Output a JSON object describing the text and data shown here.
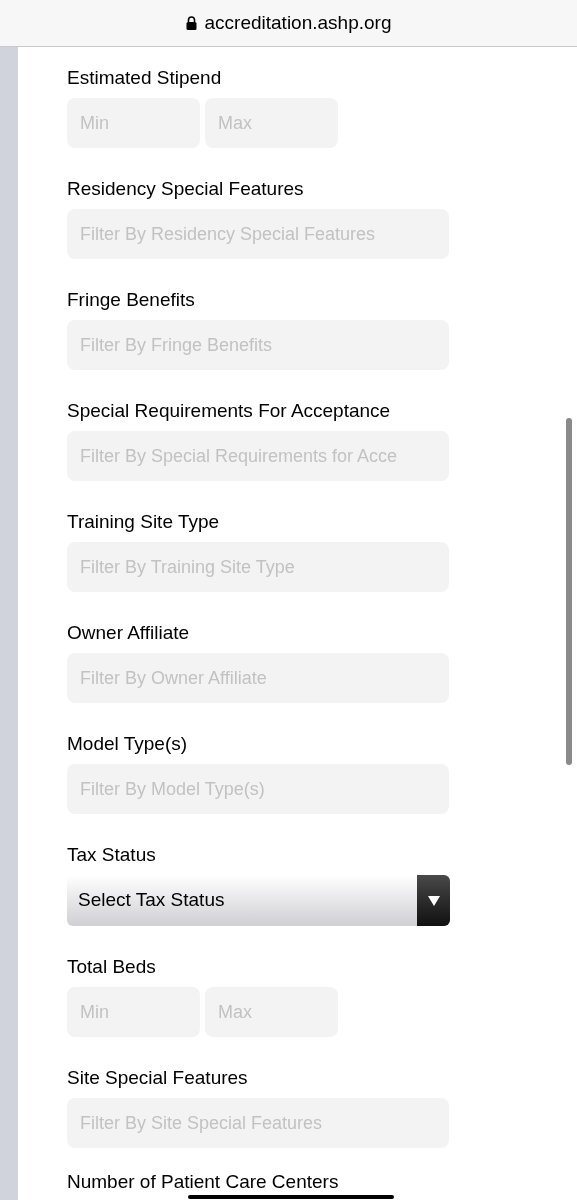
{
  "browser_bar": {
    "url": "accreditation.ashp.org"
  },
  "filters": [
    {
      "kind": "range",
      "label": "Estimated Stipend",
      "placeholders": [
        "Min",
        "Max"
      ]
    },
    {
      "kind": "text",
      "label": "Residency Special Features",
      "placeholder": "Filter By Residency Special Features"
    },
    {
      "kind": "text",
      "label": "Fringe Benefits",
      "placeholder": "Filter By Fringe Benefits"
    },
    {
      "kind": "text",
      "label": "Special Requirements For Acceptance",
      "placeholder": "Filter By Special Requirements for Acce"
    },
    {
      "kind": "text",
      "label": "Training Site Type",
      "placeholder": "Filter By Training Site Type"
    },
    {
      "kind": "text",
      "label": "Owner Affiliate",
      "placeholder": "Filter By Owner Affiliate"
    },
    {
      "kind": "text",
      "label": "Model Type(s)",
      "placeholder": "Filter By Model Type(s)"
    },
    {
      "kind": "select",
      "label": "Tax Status",
      "value": "Select Tax Status"
    },
    {
      "kind": "range",
      "label": "Total Beds",
      "placeholders": [
        "Min",
        "Max"
      ]
    },
    {
      "kind": "text",
      "label": "Site Special Features",
      "placeholder": "Filter By Site Special Features"
    },
    {
      "kind": "heading",
      "label": "Number of Patient Care Centers"
    }
  ]
}
